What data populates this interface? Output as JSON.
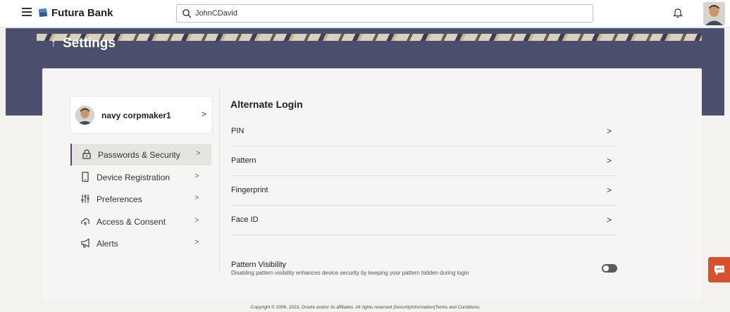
{
  "header": {
    "brand_name": "Futura Bank",
    "search_value": "JohnCDavid",
    "search_placeholder": "",
    "icons": [
      "hamburger-icon",
      "bank-logo-icon",
      "search-icon",
      "bell-icon",
      "user-avatar"
    ]
  },
  "page": {
    "title": "Settings",
    "back_icon": "↑"
  },
  "profile": {
    "name": "navy corpmaker1",
    "chevron": ">"
  },
  "sidebar": {
    "items": [
      {
        "label": "Passwords & Security",
        "icon": "lock-icon",
        "active": true
      },
      {
        "label": "Device Registration",
        "icon": "mobile-device-icon",
        "active": false
      },
      {
        "label": "Preferences",
        "icon": "sliders-icon",
        "active": false
      },
      {
        "label": "Access & Consent",
        "icon": "cloud-access-icon",
        "active": false
      },
      {
        "label": "Alerts",
        "icon": "megaphone-icon",
        "active": false
      }
    ],
    "chevron": ">"
  },
  "content": {
    "section_title": "Alternate Login",
    "options": [
      {
        "label": "PIN"
      },
      {
        "label": "Pattern"
      },
      {
        "label": "Fingerprint"
      },
      {
        "label": "Face ID"
      }
    ],
    "chevron": ">",
    "pattern_visibility": {
      "title": "Pattern Visibility",
      "description": "Disabling pattern visibility enhances device security by keeping your pattern hidden during login",
      "enabled": false
    }
  },
  "footer": {
    "text": "Copyright © 2006, 2023, Oracle and/or its affiliates. All rights reserved.|SecurityInformation|Terms and Conditions"
  },
  "colors": {
    "banner": "#4a4f6e",
    "chat_button": "#d9512c",
    "active_menu_bg": "#e6e4e1"
  }
}
